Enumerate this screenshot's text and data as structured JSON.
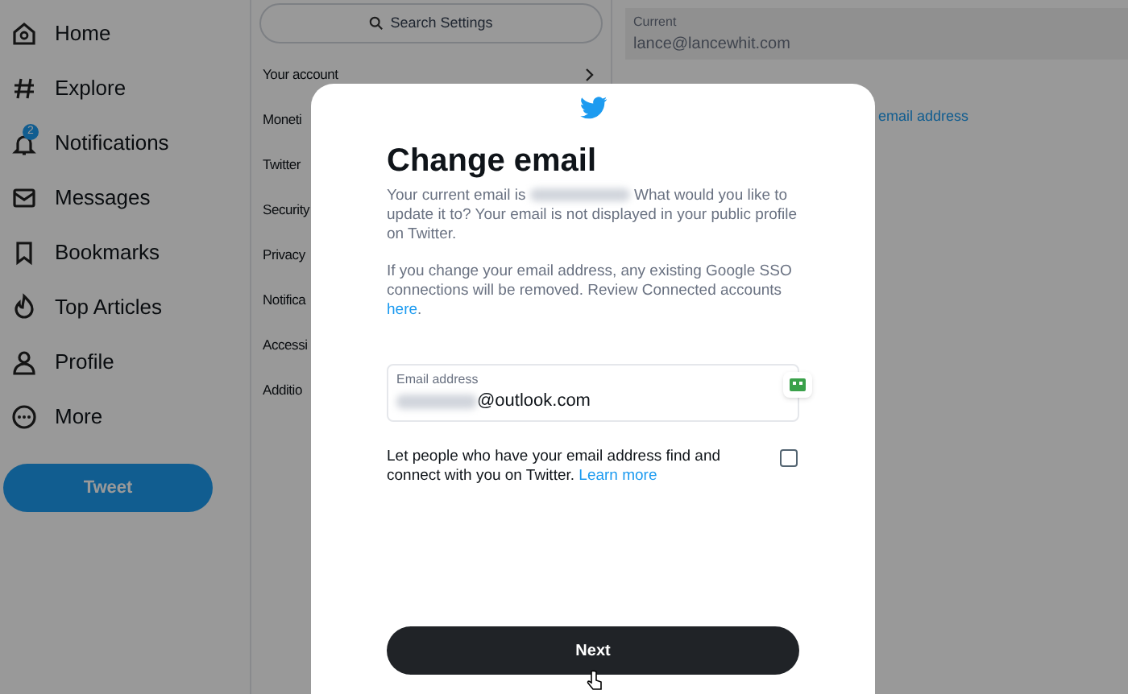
{
  "sidebar": {
    "items": [
      {
        "label": "Home"
      },
      {
        "label": "Explore"
      },
      {
        "label": "Notifications",
        "badge": "2"
      },
      {
        "label": "Messages"
      },
      {
        "label": "Bookmarks"
      },
      {
        "label": "Top Articles"
      },
      {
        "label": "Profile"
      },
      {
        "label": "More"
      }
    ],
    "tweet_button": "Tweet"
  },
  "settings": {
    "search_placeholder": "Search Settings",
    "items": [
      "Your account",
      "Moneti",
      "Twitter",
      "Security",
      "Privacy",
      "Notifica",
      "Accessi",
      "Additio"
    ]
  },
  "detail": {
    "current_label": "Current",
    "current_value": "lance@lancewhit.com",
    "link": "email address"
  },
  "dialog": {
    "title": "Change email",
    "intro_before": "Your current email is",
    "intro_after": "What would you like to update it to? Your email is not displayed in your public profile on Twitter.",
    "notice": "If you change your email address, any existing Google SSO connections will be removed. Review Connected accounts",
    "notice_link": "here",
    "notice_end": ".",
    "field_label": "Email address",
    "field_value": "@outlook.com",
    "discover_text": "Let people who have your email address find and connect with you on Twitter.",
    "discover_link": "Learn more",
    "discover_checked": false,
    "next_button": "Next"
  }
}
